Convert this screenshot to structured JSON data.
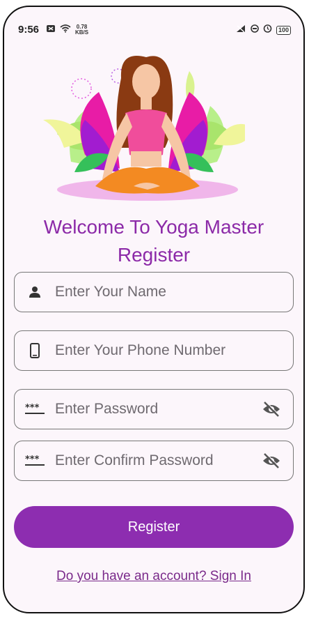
{
  "status_bar": {
    "time": "9:56",
    "net_speed_value": "0.78",
    "net_speed_unit": "KB/S",
    "battery": "100"
  },
  "header": {
    "title_line1": "Welcome To Yoga Master",
    "title_line2": "Register"
  },
  "form": {
    "name_placeholder": "Enter Your Name",
    "phone_placeholder": "Enter Your Phone Number",
    "password_placeholder": "Enter Password",
    "confirm_password_placeholder": "Enter Confirm Password"
  },
  "actions": {
    "register_label": "Register",
    "signin_link": "Do you have an account? Sign In"
  },
  "colors": {
    "accent": "#8d2db0",
    "title": "#8c2aa8",
    "background": "#fcf6fb"
  },
  "icons": [
    "person-icon",
    "phone-icon",
    "password-dots-icon",
    "visibility-off-icon"
  ]
}
